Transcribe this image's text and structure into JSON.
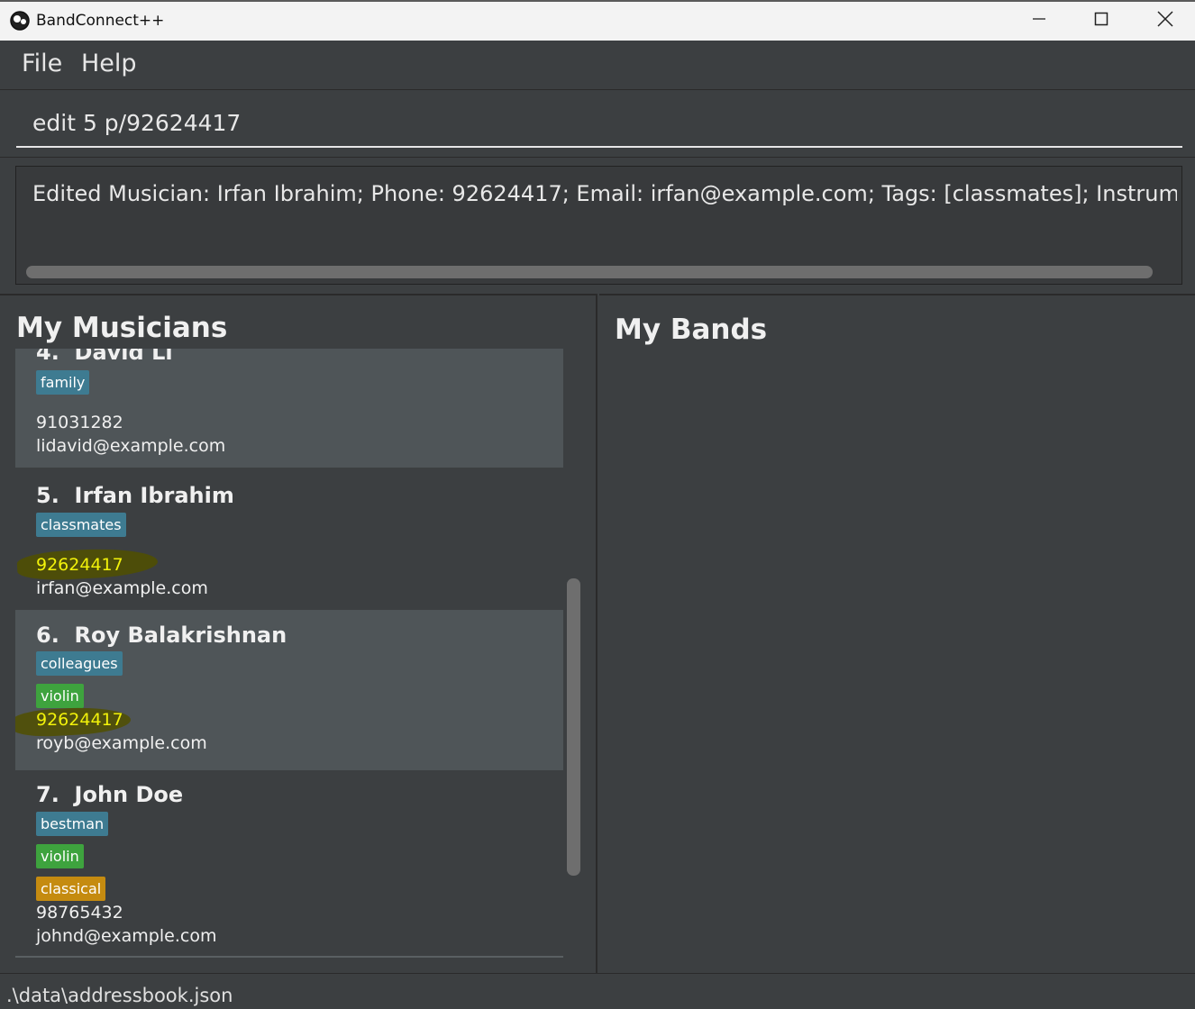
{
  "window": {
    "title": "BandConnect++",
    "icon": "app-logo-icon",
    "controls": [
      "minimize-icon",
      "maximize-icon",
      "close-icon"
    ]
  },
  "menu": {
    "items": [
      {
        "label": "File"
      },
      {
        "label": "Help"
      }
    ]
  },
  "command": {
    "value": "edit 5 p/92624417"
  },
  "result": {
    "text": "Edited Musician: Irfan Ibrahim; Phone: 92624417; Email: irfan@example.com; Tags: [classmates]; Instruments: ; Genres: "
  },
  "musicians": {
    "title": "My Musicians",
    "cards": [
      {
        "index": "4.",
        "name": "David Li",
        "tags": [
          "family"
        ],
        "instruments": [],
        "genres": [],
        "phone": "91031282",
        "email": "lidavid@example.com",
        "phone_highlighted": false
      },
      {
        "index": "5.",
        "name": "Irfan Ibrahim",
        "tags": [
          "classmates"
        ],
        "instruments": [],
        "genres": [],
        "phone": "92624417",
        "email": "irfan@example.com",
        "phone_highlighted": true
      },
      {
        "index": "6.",
        "name": "Roy Balakrishnan",
        "tags": [
          "colleagues"
        ],
        "instruments": [
          "violin"
        ],
        "genres": [],
        "phone": "92624417",
        "email": "royb@example.com",
        "phone_highlighted": true
      },
      {
        "index": "7.",
        "name": "John Doe",
        "tags": [
          "bestman"
        ],
        "instruments": [
          "violin"
        ],
        "genres": [
          "classical"
        ],
        "phone": "98765432",
        "email": "johnd@example.com",
        "phone_highlighted": false
      }
    ]
  },
  "bands": {
    "title": "My Bands"
  },
  "status": {
    "path": ".\\data\\addressbook.json"
  },
  "colors": {
    "tag": "#3e7b91",
    "instrument": "#3ea33e",
    "genre": "#c58b10",
    "highlight_text": "#f2f20a"
  }
}
